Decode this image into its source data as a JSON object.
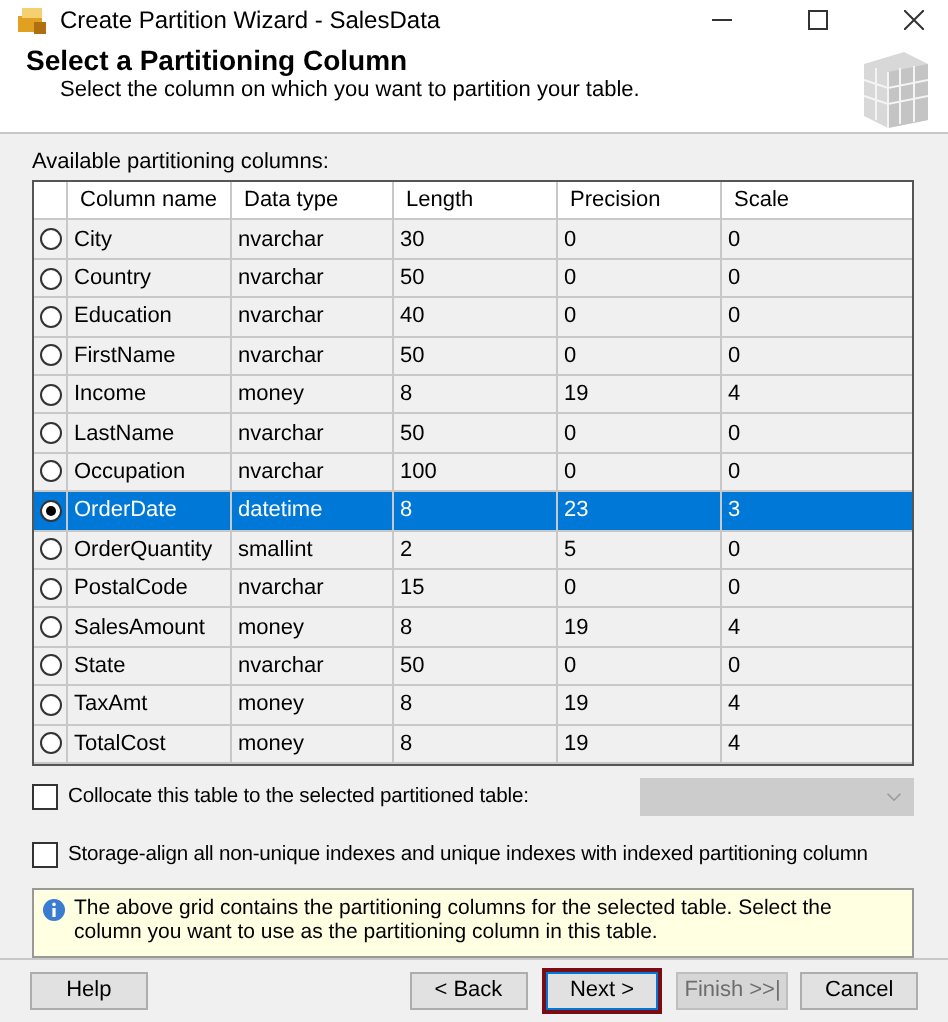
{
  "window": {
    "title": "Create Partition Wizard - SalesData"
  },
  "header": {
    "title": "Select a Partitioning Column",
    "subtitle": "Select the column on which you want to partition your table."
  },
  "table": {
    "label": "Available partitioning columns:",
    "columns": [
      "Column name",
      "Data type",
      "Length",
      "Precision",
      "Scale"
    ],
    "rows": [
      {
        "cells": [
          "City",
          "nvarchar",
          "30",
          "0",
          "0"
        ],
        "selected": false
      },
      {
        "cells": [
          "Country",
          "nvarchar",
          "50",
          "0",
          "0"
        ],
        "selected": false
      },
      {
        "cells": [
          "Education",
          "nvarchar",
          "40",
          "0",
          "0"
        ],
        "selected": false
      },
      {
        "cells": [
          "FirstName",
          "nvarchar",
          "50",
          "0",
          "0"
        ],
        "selected": false
      },
      {
        "cells": [
          "Income",
          "money",
          "8",
          "19",
          "4"
        ],
        "selected": false
      },
      {
        "cells": [
          "LastName",
          "nvarchar",
          "50",
          "0",
          "0"
        ],
        "selected": false
      },
      {
        "cells": [
          "Occupation",
          "nvarchar",
          "100",
          "0",
          "0"
        ],
        "selected": false
      },
      {
        "cells": [
          "OrderDate",
          "datetime",
          "8",
          "23",
          "3"
        ],
        "selected": true
      },
      {
        "cells": [
          "OrderQuantity",
          "smallint",
          "2",
          "5",
          "0"
        ],
        "selected": false
      },
      {
        "cells": [
          "PostalCode",
          "nvarchar",
          "15",
          "0",
          "0"
        ],
        "selected": false
      },
      {
        "cells": [
          "SalesAmount",
          "money",
          "8",
          "19",
          "4"
        ],
        "selected": false
      },
      {
        "cells": [
          "State",
          "nvarchar",
          "50",
          "0",
          "0"
        ],
        "selected": false
      },
      {
        "cells": [
          "TaxAmt",
          "money",
          "8",
          "19",
          "4"
        ],
        "selected": false
      },
      {
        "cells": [
          "TotalCost",
          "money",
          "8",
          "19",
          "4"
        ],
        "selected": false
      }
    ]
  },
  "options": [
    {
      "label": "Collocate this table to the selected partitioned table:",
      "checked": false,
      "dropdown": {
        "disabled": true
      }
    },
    {
      "label": "Storage-align all non-unique indexes and unique indexes with indexed partitioning column",
      "checked": false
    }
  ],
  "info": "The above grid contains the partitioning columns for the selected table. Select the column you want to use as the partitioning column in this table.",
  "buttons": [
    {
      "label": "Help",
      "disabled": false,
      "focused": false
    },
    {
      "label": "< Back",
      "disabled": false,
      "focused": false
    },
    {
      "label": "Next >",
      "disabled": false,
      "focused": true
    },
    {
      "label": "Finish >>|",
      "disabled": true,
      "focused": false
    },
    {
      "label": "Cancel",
      "disabled": false,
      "focused": false
    }
  ]
}
